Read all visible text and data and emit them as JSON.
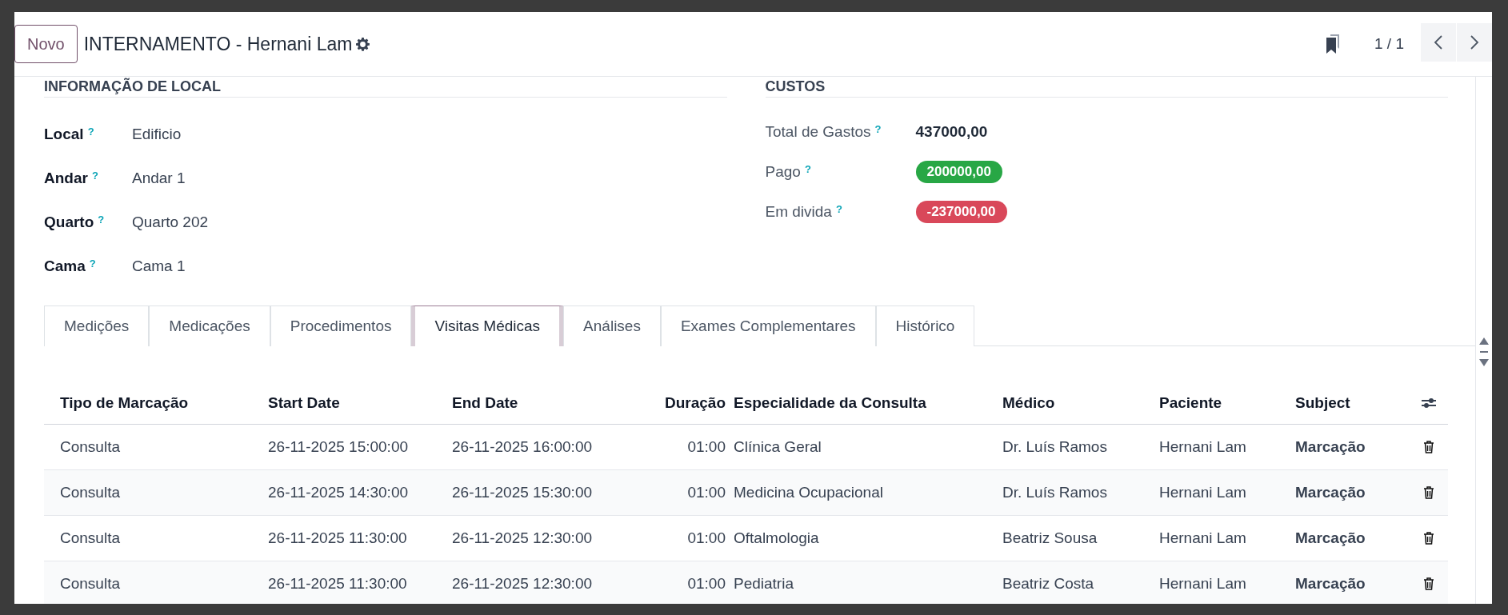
{
  "header": {
    "new_button": "Novo",
    "title": "INTERNAMENTO - Hernani Lam",
    "pager": "1 / 1"
  },
  "location": {
    "title": "INFORMAÇÃO DE LOCAL",
    "fields": [
      {
        "label": "Local",
        "help": "?",
        "value": "Edificio"
      },
      {
        "label": "Andar",
        "help": "?",
        "value": "Andar 1"
      },
      {
        "label": "Quarto",
        "help": "?",
        "value": "Quarto 202"
      },
      {
        "label": "Cama",
        "help": "?",
        "value": "Cama 1"
      }
    ]
  },
  "costs": {
    "title": "CUSTOS",
    "fields": [
      {
        "label": "Total de Gastos",
        "help": "?",
        "value": "437000,00",
        "kind": "plain"
      },
      {
        "label": "Pago",
        "help": "?",
        "value": "200000,00",
        "kind": "badge",
        "color": "#28a745"
      },
      {
        "label": "Em divida",
        "help": "?",
        "value": "-237000,00",
        "kind": "badge",
        "color": "#d9485a"
      }
    ]
  },
  "tabs": [
    {
      "label": "Medições",
      "selected": false
    },
    {
      "label": "Medicações",
      "selected": false
    },
    {
      "label": "Procedimentos",
      "selected": false
    },
    {
      "label": "Visitas Médicas",
      "selected": true
    },
    {
      "label": "Análises",
      "selected": false
    },
    {
      "label": "Exames Complementares",
      "selected": false
    },
    {
      "label": "Histórico",
      "selected": false
    }
  ],
  "table": {
    "columns": [
      "Tipo de Marcação",
      "Start Date",
      "End Date",
      "Duração",
      "Especialidade da Consulta",
      "Médico",
      "Paciente",
      "Subject"
    ],
    "rows": [
      [
        "Consulta",
        "26-11-2025 15:00:00",
        "26-11-2025 16:00:00",
        "01:00",
        "Clínica Geral",
        "Dr. Luís Ramos",
        "Hernani Lam",
        "Marcação"
      ],
      [
        "Consulta",
        "26-11-2025 14:30:00",
        "26-11-2025 15:30:00",
        "01:00",
        "Medicina Ocupacional",
        "Dr. Luís Ramos",
        "Hernani Lam",
        "Marcação"
      ],
      [
        "Consulta",
        "26-11-2025 11:30:00",
        "26-11-2025 12:30:00",
        "01:00",
        "Oftalmologia",
        "Beatriz Sousa",
        "Hernani Lam",
        "Marcação"
      ],
      [
        "Consulta",
        "26-11-2025 11:30:00",
        "26-11-2025 12:30:00",
        "01:00",
        "Pediatria",
        "Beatriz Costa",
        "Hernani Lam",
        "Marcação"
      ]
    ]
  }
}
